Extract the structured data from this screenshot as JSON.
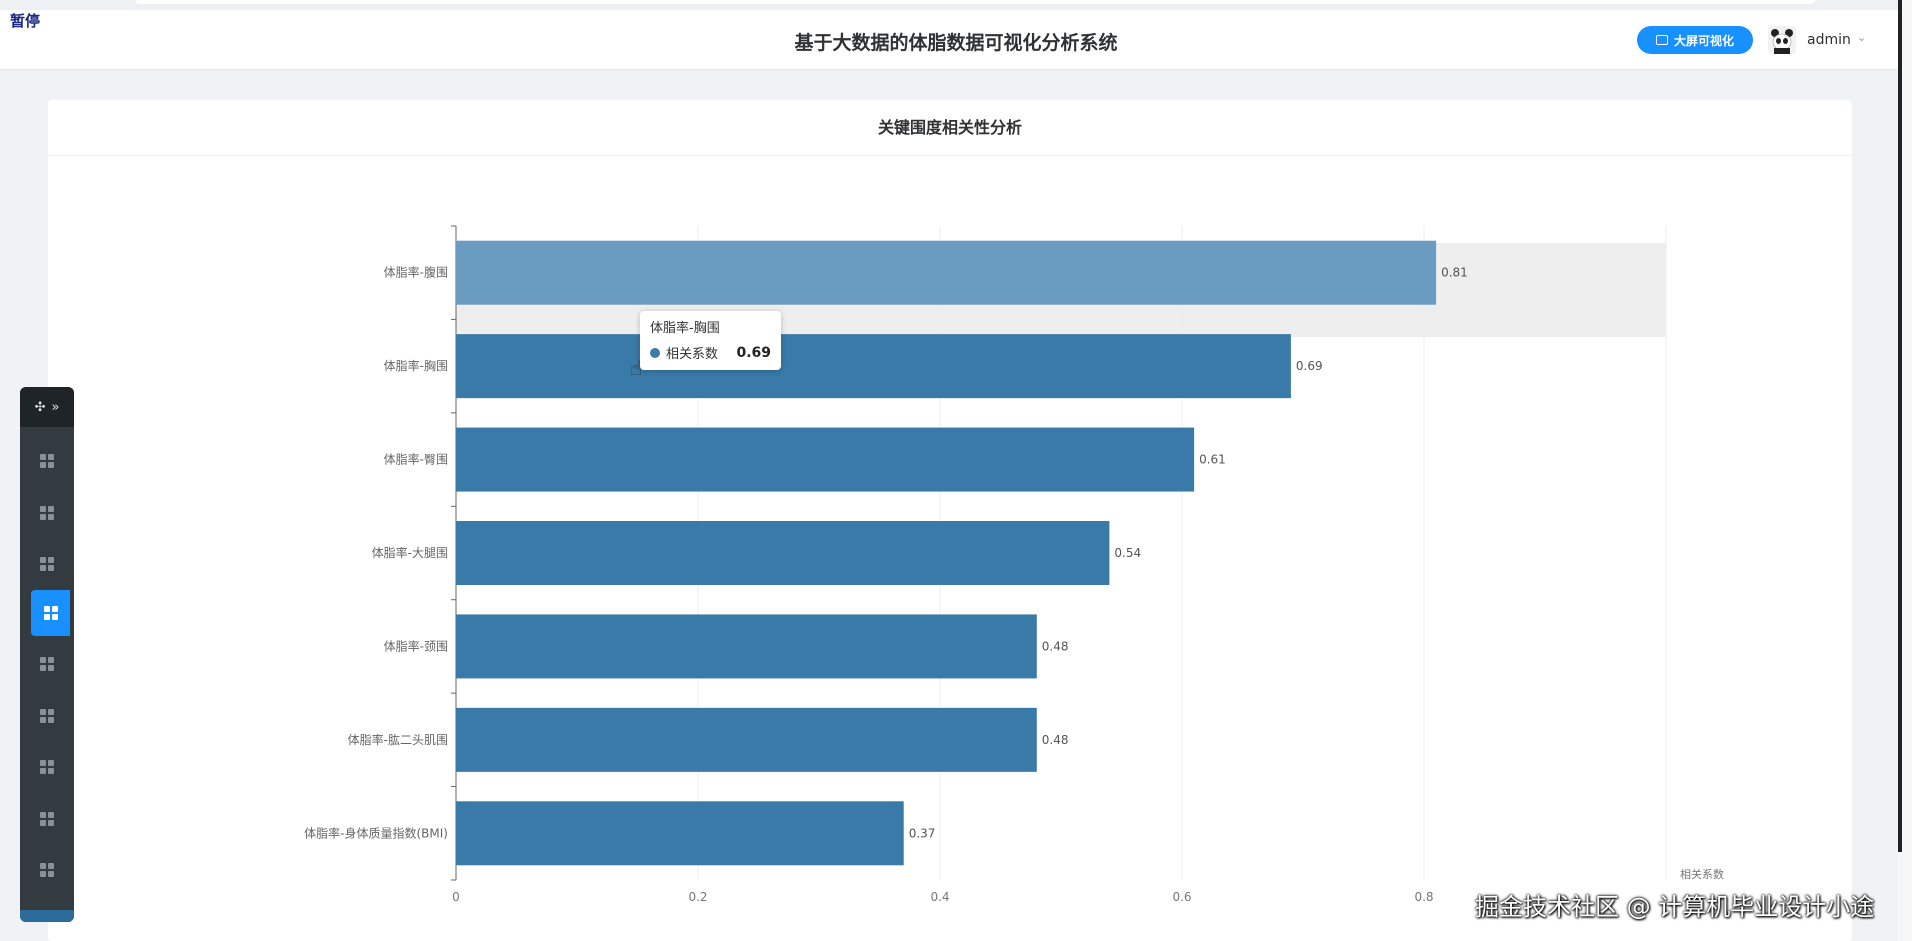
{
  "header": {
    "pause_label": "暂停",
    "title": "基于大数据的体脂数据可视化分析系统",
    "bigscreen_label": "大屏可视化",
    "username": "admin"
  },
  "panel": {
    "title": "关键围度相关性分析"
  },
  "tooltip": {
    "title": "体脂率-胸围",
    "series": "相关系数",
    "value": "0.69"
  },
  "watermark": "掘金技术社区 @ 计算机毕业设计小途",
  "colors": {
    "bar": "#3a7aa8",
    "bar_highlight": "#6a9bc0",
    "accent": "#1890ff"
  },
  "icons": {
    "sidebar_head": "move-icon",
    "sidebar_item": "grid-icon",
    "bigscreen": "monitor-icon",
    "user": "panda-avatar-icon"
  },
  "chart_data": {
    "type": "bar",
    "orientation": "horizontal",
    "categories": [
      "体脂率-腹围",
      "体脂率-胸围",
      "体脂率-臀围",
      "体脂率-大腿围",
      "体脂率-颈围",
      "体脂率-肱二头肌围",
      "体脂率-身体质量指数(BMI)"
    ],
    "values": [
      0.81,
      0.69,
      0.61,
      0.54,
      0.48,
      0.48,
      0.37
    ],
    "series": [
      {
        "name": "相关系数",
        "values": [
          0.81,
          0.69,
          0.61,
          0.54,
          0.48,
          0.48,
          0.37
        ]
      }
    ],
    "xlabel": "相关系数",
    "xlim": [
      0,
      1
    ],
    "xticks": [
      "0",
      "0.2",
      "0.4",
      "0.6",
      "0.8"
    ],
    "highlighted": "体脂率-腹围",
    "grid": true,
    "value_labels": true
  }
}
